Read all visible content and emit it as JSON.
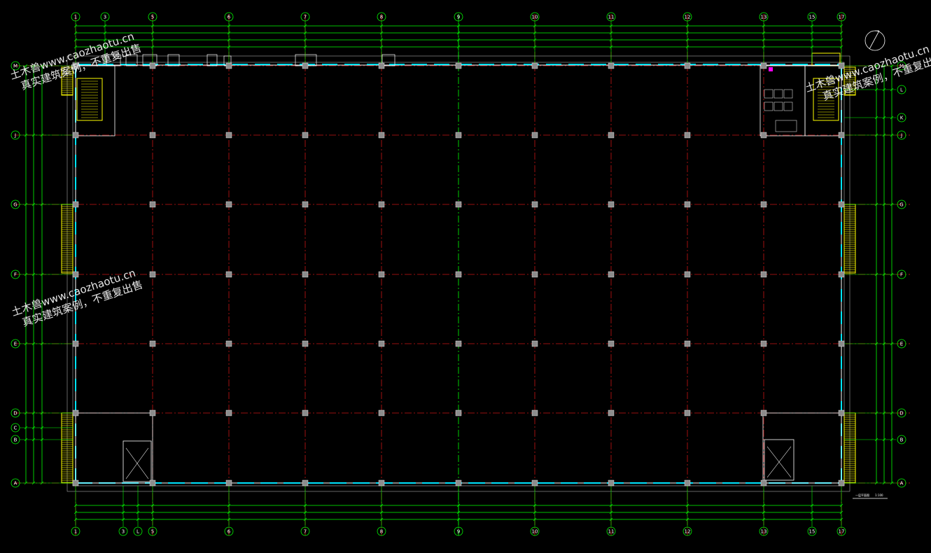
{
  "drawing": {
    "axes_top": [
      "1",
      "3",
      "5",
      "6",
      "7",
      "8",
      "9",
      "10",
      "11",
      "12",
      "13",
      "15",
      "17"
    ],
    "axes_bottom": [
      "1",
      "3",
      "L",
      "5",
      "6",
      "7",
      "8",
      "9",
      "10",
      "11",
      "12",
      "13",
      "15",
      "17"
    ],
    "axes_left": [
      "M",
      "J",
      "G",
      "F",
      "E",
      "D",
      "C",
      "B",
      "A"
    ],
    "axes_right": [
      "M",
      "L",
      "K",
      "J",
      "G",
      "F",
      "E",
      "D",
      "B",
      "A"
    ],
    "title": "一层平面图",
    "scale": "1:100"
  },
  "watermark": {
    "site": "土木兽www.caozhaotu.cn",
    "slogan": "真实建筑案例，不重复出售"
  },
  "colors": {
    "background": "#000000",
    "axis_green": "#00ff00",
    "grid_red": "#c81414",
    "wall_cyan": "#00e5ff",
    "stair_yellow": "#ffff00",
    "column_grey": "#8c8c8c",
    "text_white": "#ffffff"
  }
}
